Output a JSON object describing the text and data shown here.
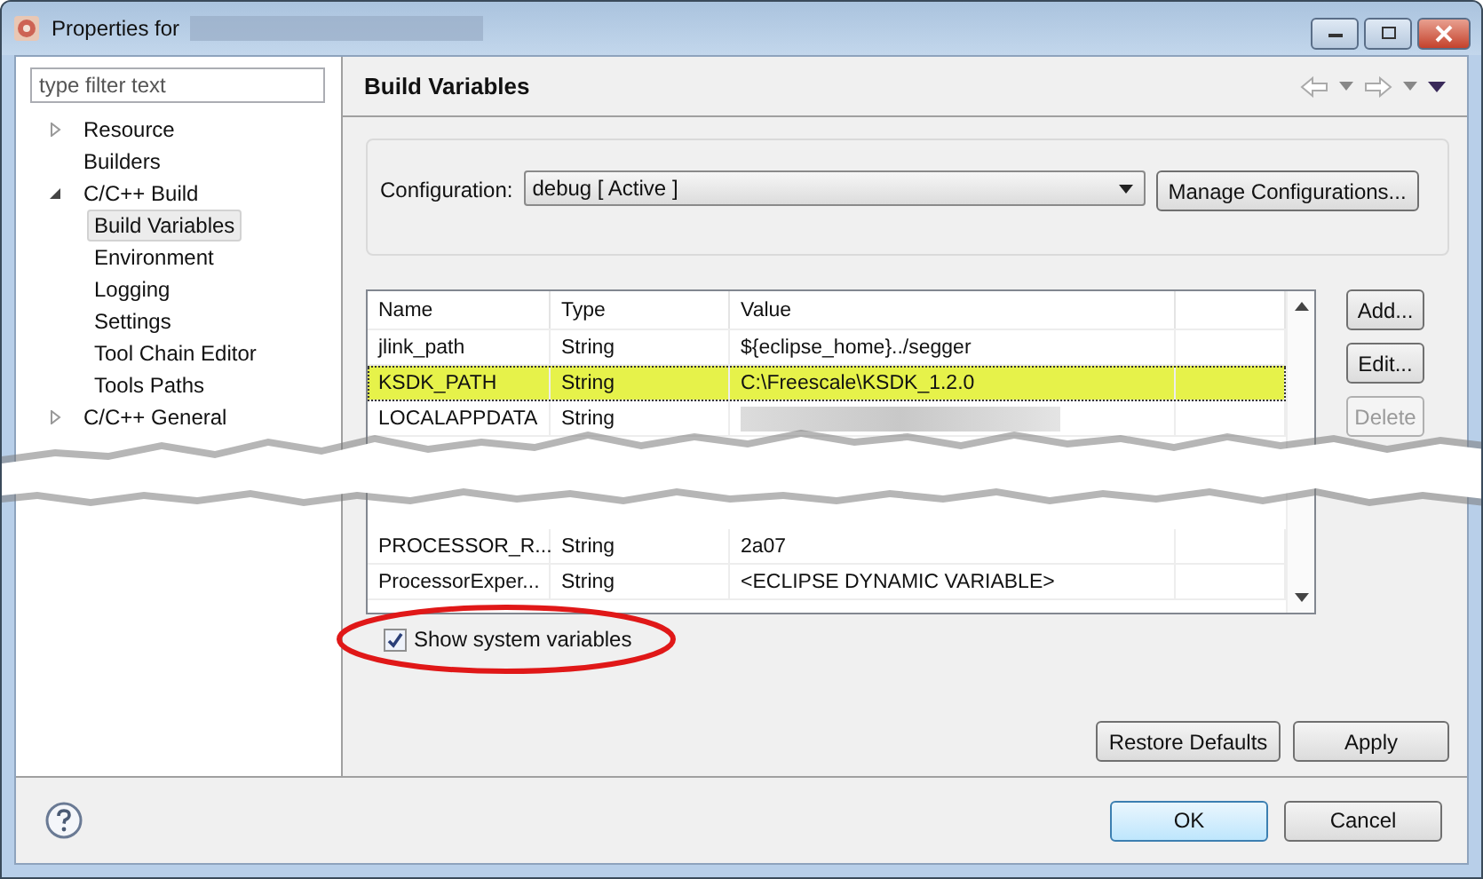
{
  "window": {
    "title": "Properties for"
  },
  "filter": {
    "placeholder": "type filter text"
  },
  "tree": [
    {
      "label": "Resource",
      "expanded": false,
      "selected": false
    },
    {
      "label": "Builders",
      "selected": false
    },
    {
      "label": "C/C++ Build",
      "expanded": true,
      "selected": false,
      "children": [
        {
          "label": "Build Variables",
          "selected": true
        },
        {
          "label": "Environment",
          "selected": false
        },
        {
          "label": "Logging",
          "selected": false
        },
        {
          "label": "Settings",
          "selected": false
        },
        {
          "label": "Tool Chain Editor",
          "selected": false
        },
        {
          "label": "Tools Paths",
          "selected": false
        }
      ]
    },
    {
      "label": "C/C++ General",
      "expanded": false,
      "selected": false
    }
  ],
  "page_title": "Build Variables",
  "configuration": {
    "label": "Configuration:",
    "value": "debug  [ Active ]",
    "manage_button": "Manage Configurations..."
  },
  "table": {
    "columns": [
      "Name",
      "Type",
      "Value"
    ],
    "rows_top": [
      {
        "name": "jlink_path",
        "type": "String",
        "value": "${eclipse_home}../segger",
        "selected": false
      },
      {
        "name": "KSDK_PATH",
        "type": "String",
        "value": "C:\\Freescale\\KSDK_1.2.0",
        "selected": true
      },
      {
        "name": "LOCALAPPDATA",
        "type": "String",
        "selected": false
      }
    ],
    "rows_bottom": [
      {
        "name": "PROCESSOR_R...",
        "type": "String",
        "value": "2a07",
        "selected": false
      },
      {
        "name": "ProcessorExper...",
        "type": "String",
        "value": "<ECLIPSE DYNAMIC VARIABLE>",
        "selected": false
      }
    ]
  },
  "side_buttons": [
    {
      "label": "Add...",
      "disabled": false
    },
    {
      "label": "Edit...",
      "disabled": false
    },
    {
      "label": "Delete",
      "disabled": true
    }
  ],
  "show_system_variables": {
    "label": "Show system variables",
    "checked": true
  },
  "page_buttons": [
    "Restore Defaults",
    "Apply"
  ],
  "dialog_buttons": [
    {
      "label": "OK",
      "default": true
    },
    {
      "label": "Cancel",
      "default": false
    }
  ]
}
